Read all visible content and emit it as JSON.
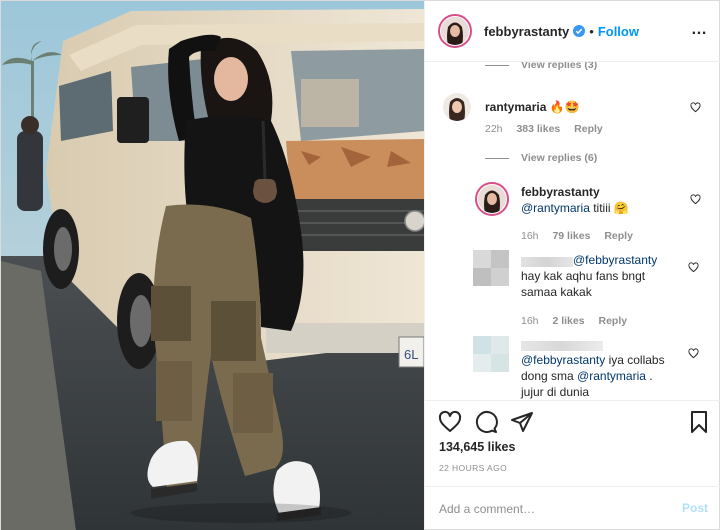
{
  "header": {
    "username": "febbyrastanty",
    "separator": "•",
    "follow_label": "Follow",
    "more_label": "…"
  },
  "comments": {
    "view_replies_top": "View replies (3)",
    "c1": {
      "username": "rantymaria",
      "text": "🔥🤩",
      "time": "22h",
      "likes": "383 likes",
      "reply": "Reply"
    },
    "view_replies_mid": "View replies (6)",
    "c2": {
      "username": "febbyrastanty",
      "mention": "@rantymaria",
      "text": " titiii 🤗",
      "time": "16h",
      "likes": "79 likes",
      "reply": "Reply"
    },
    "c3": {
      "text": "hay kak aqhu fans bngt samaa kakak",
      "mention": "@febbyrastanty",
      "time": "16h",
      "likes": "2 likes",
      "reply": "Reply"
    },
    "c4": {
      "mention1": "@febbyrastanty",
      "text1": " iya collabs dong sma ",
      "mention2": "@rantymaria",
      "text2": " .",
      "text3": "jujur di dunia"
    }
  },
  "actions": {
    "likes_count": "134,645 likes",
    "time_ago": "22 HOURS AGO"
  },
  "composer": {
    "placeholder": "Add a comment…",
    "post_label": "Post"
  },
  "photo": {
    "plate_text": "6L"
  },
  "colors": {
    "link_blue": "#0095f6",
    "mention_blue": "#00376b",
    "story_ring": "#d94f8a",
    "muted_gray": "#8e8e8e"
  },
  "icons": [
    "verified-badge-icon",
    "more-options-icon",
    "heart-icon",
    "comment-icon",
    "share-icon",
    "bookmark-icon"
  ]
}
